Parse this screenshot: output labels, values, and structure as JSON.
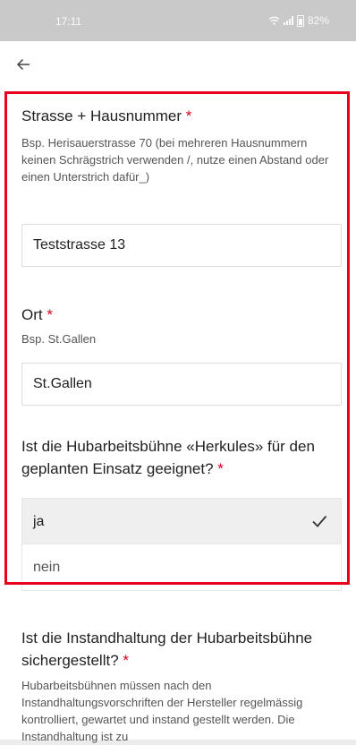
{
  "status_bar": {
    "time": "17:11",
    "battery": "82%"
  },
  "colors": {
    "required_asterisk": "#d6001c",
    "highlight_frame": "#e8001c"
  },
  "form": {
    "street": {
      "label": "Strasse + Hausnummer",
      "required_mark": "*",
      "hint": "Bsp. Herisauerstrasse 70 (bei mehreren Hausnummern keinen Schrägstrich verwenden /, nutze einen Abstand oder einen Unterstrich dafür_)",
      "value": "Teststrasse 13"
    },
    "city": {
      "label": "Ort",
      "required_mark": "*",
      "hint": "Bsp. St.Gallen",
      "value": "St.Gallen"
    },
    "suitability": {
      "question": "Ist die Hubarbeitsbühne «Herkules» für den geplanten Einsatz geeignet?",
      "required_mark": "*",
      "options": [
        {
          "label": "ja",
          "selected": true
        },
        {
          "label": "nein",
          "selected": false
        }
      ]
    },
    "maintenance": {
      "question": "Ist die Instandhaltung der Hubarbeitsbühne sichergestellt?",
      "required_mark": "*",
      "hint": "Hubarbeitsbühnen müssen nach den Instandhaltungsvorschriften der Hersteller regelmässig kontrolliert, gewartet und instand gestellt werden. Die Instandhaltung ist zu"
    }
  }
}
